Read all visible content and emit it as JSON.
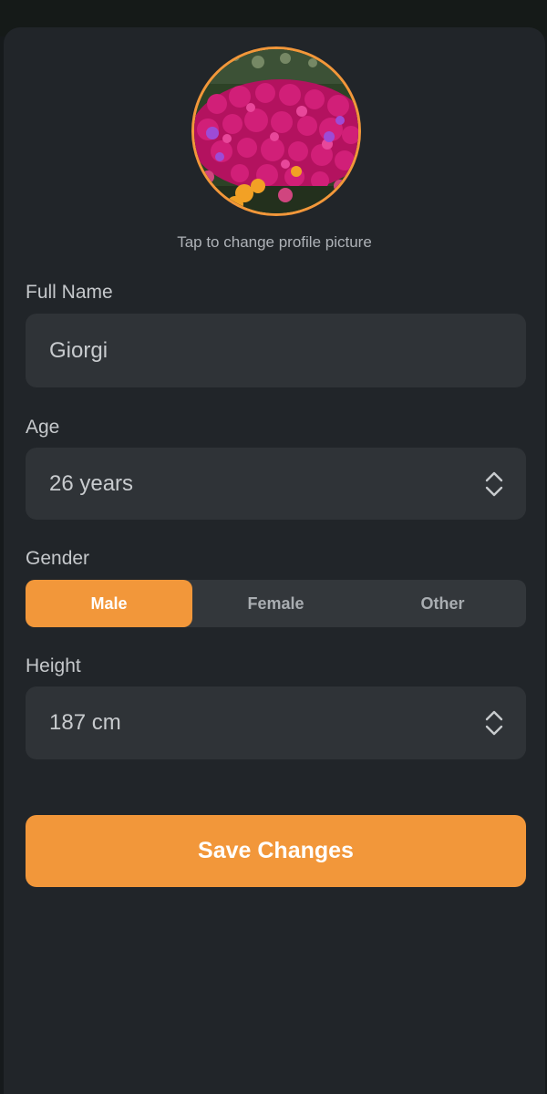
{
  "profile": {
    "change_picture_hint": "Tap to change profile picture"
  },
  "form": {
    "full_name": {
      "label": "Full Name",
      "value": "Giorgi"
    },
    "age": {
      "label": "Age",
      "value": "26 years"
    },
    "gender": {
      "label": "Gender",
      "options": [
        "Male",
        "Female",
        "Other"
      ],
      "selected": "Male"
    },
    "height": {
      "label": "Height",
      "value": "187 cm"
    }
  },
  "actions": {
    "save_label": "Save Changes"
  },
  "colors": {
    "accent": "#f2973a",
    "background": "#212529",
    "field": "#2f3337"
  },
  "icons": {
    "stepper": "chevron-up-down-icon"
  }
}
